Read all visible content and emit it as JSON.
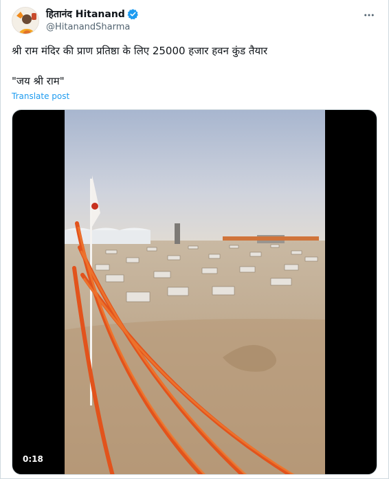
{
  "author": {
    "display_name": "हितानंद Hitanand",
    "handle": "@HitanandSharma",
    "verified": true,
    "avatar_icon": "profile-photo-avatar"
  },
  "post": {
    "line1": "श्री राम मंदिर की प्राण प्रतिष्ठा  के लिए 25000 हजार हवन कुंड तैयार",
    "line2": "\"जय श्री राम\"",
    "translate_label": "Translate post"
  },
  "media": {
    "type": "video",
    "duration": "0:18"
  },
  "colors": {
    "link": "#1d9bf0",
    "verified": "#1d9bf0",
    "secondary_text": "#536471"
  }
}
